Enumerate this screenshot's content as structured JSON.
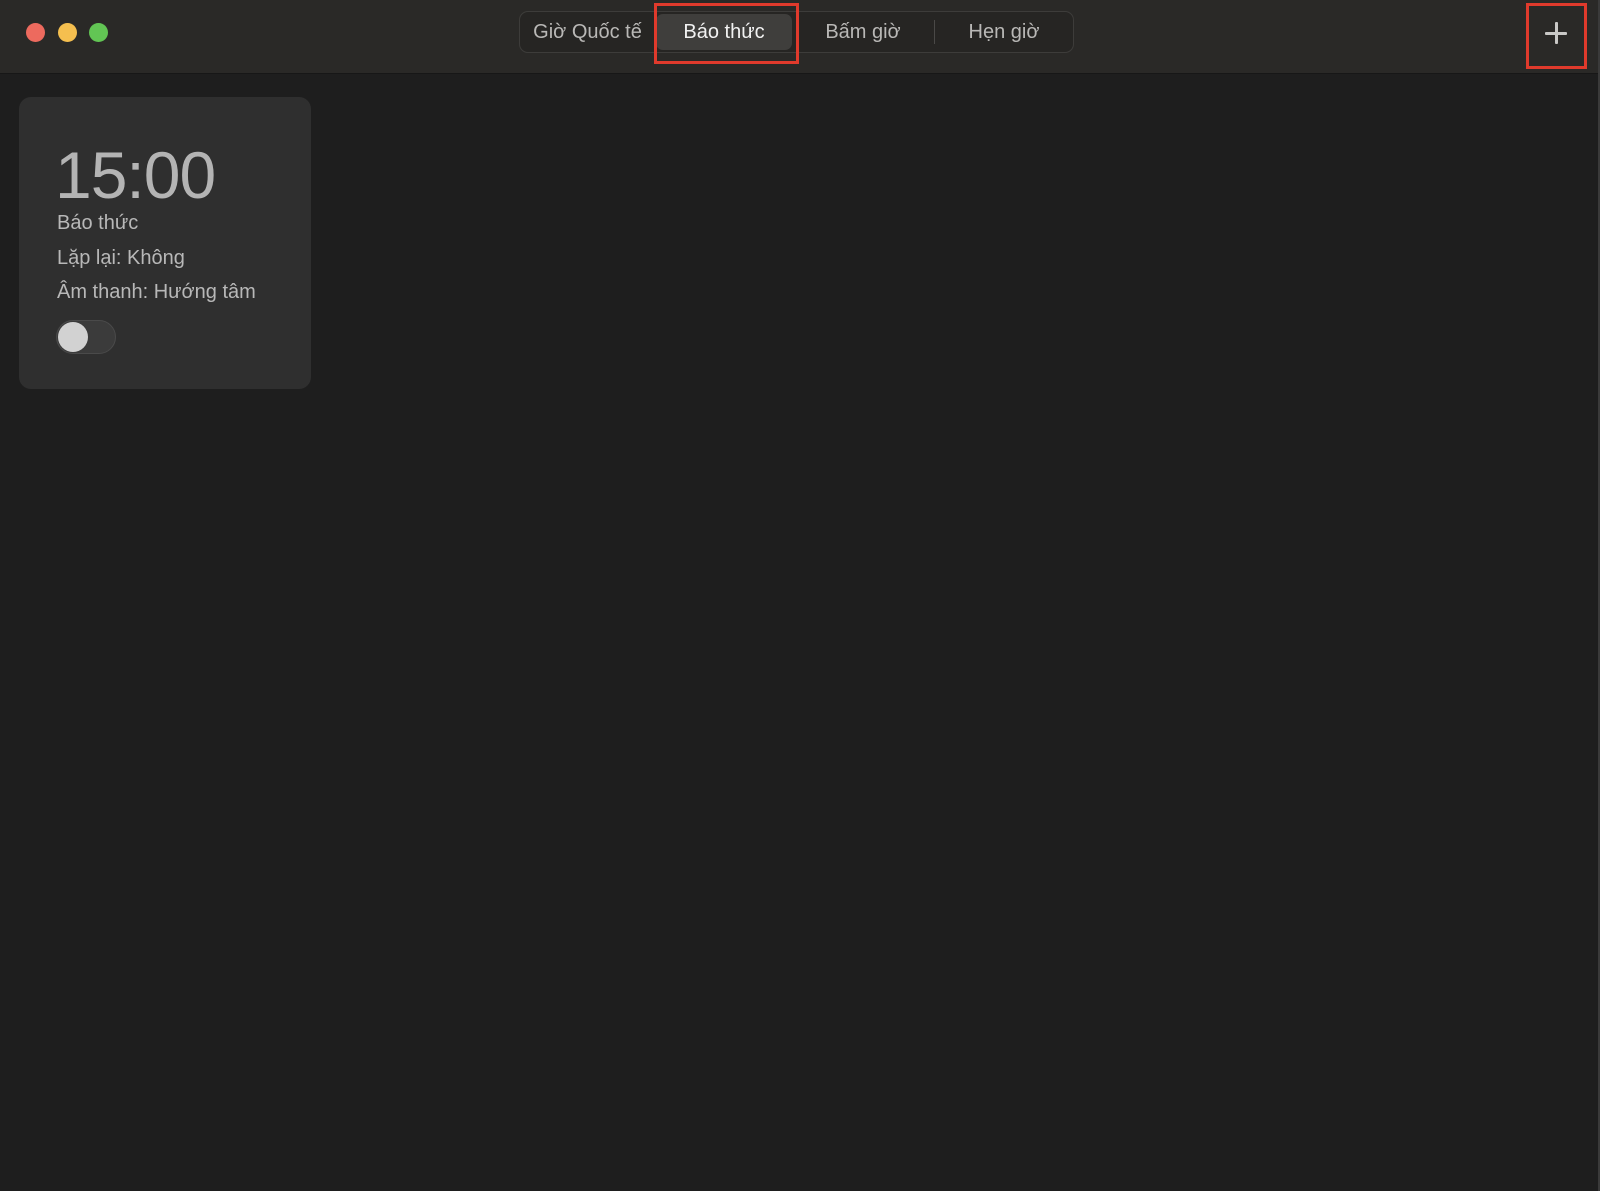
{
  "window": {
    "controls": [
      "close",
      "minimize",
      "maximize"
    ]
  },
  "tabs": [
    {
      "label": "Giờ Quốc tế",
      "selected": false
    },
    {
      "label": "Báo thức",
      "selected": true
    },
    {
      "label": "Bấm giờ",
      "selected": false
    },
    {
      "label": "Hẹn giờ",
      "selected": false
    }
  ],
  "toolbar": {
    "add_icon": "plus-icon"
  },
  "alarms": [
    {
      "time": "15:00",
      "label": "Báo thức",
      "repeat": "Lặp lại: Không",
      "sound": "Âm thanh: Hướng tâm",
      "enabled": false
    }
  ],
  "colors": {
    "highlight": "#e03a2c",
    "background": "#1e1e1e",
    "card": "#2f2f2f"
  }
}
